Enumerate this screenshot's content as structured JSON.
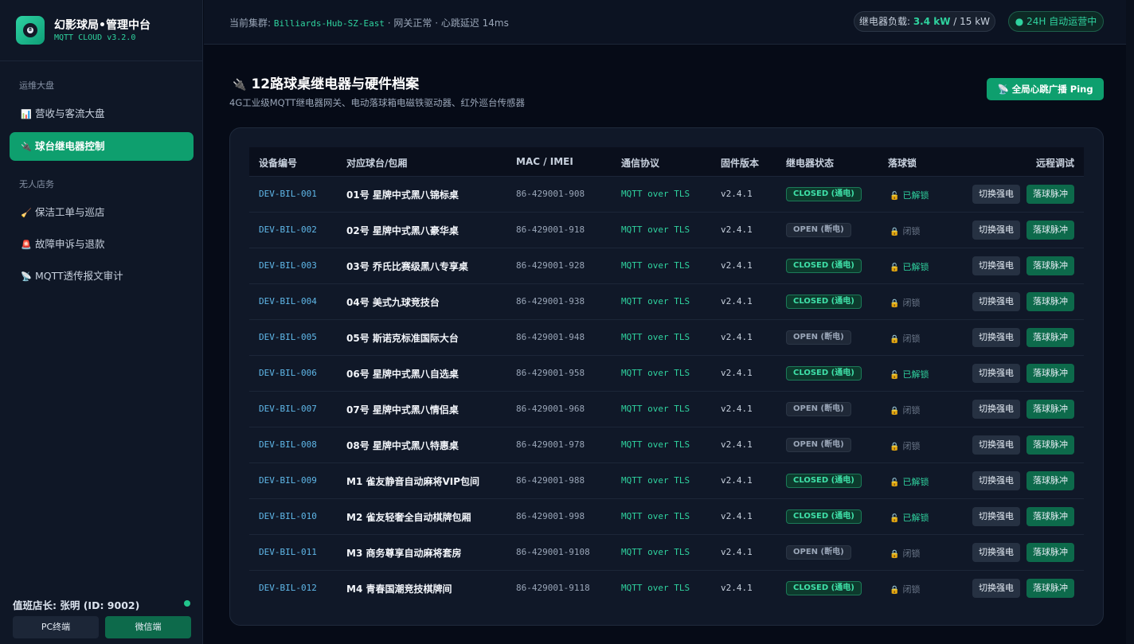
{
  "brand": {
    "title": "幻影球局•管理中台",
    "subtitle": "MQTT CLOUD v3.2.0",
    "logo_glyph": "8"
  },
  "nav": {
    "group1": "运维大盘",
    "group2": "无人店务",
    "items": [
      {
        "icon": "📊",
        "label": "营收与客流大盘"
      },
      {
        "icon": "🔌",
        "label": "球台继电器控制"
      },
      {
        "icon": "🧹",
        "label": "保洁工单与巡店"
      },
      {
        "icon": "🚨",
        "label": "故障申诉与退款"
      },
      {
        "icon": "📡",
        "label": "MQTT透传报文审计"
      }
    ]
  },
  "sidebar_footer": {
    "duty": "值班店长: 张明 (ID: 9002)",
    "pc_label": "PC终端",
    "wx_label": "微信端"
  },
  "topbar": {
    "cluster_prefix": "当前集群: ",
    "cluster_name": "Billiards-Hub-SZ-East",
    "cluster_status": " · 网关正常 · 心跳延迟 14ms",
    "load_label": "继电器负载: ",
    "load_value": "3.4 kW",
    "load_total": " / 15 kW",
    "ops_badge": "● 24H 自动运营中"
  },
  "page": {
    "title_icon": "🔌",
    "title": "12路球桌继电器与硬件档案",
    "subtitle": "4G工业级MQTT继电器网关、电动落球箱电磁铁驱动器、红外巡台传感器",
    "ping_button": "📡 全局心跳广播 Ping"
  },
  "table": {
    "headers": [
      "设备编号",
      "对应球台/包厢",
      "MAC / IMEI",
      "通信协议",
      "固件版本",
      "继电器状态",
      "落球锁",
      "远程调试"
    ],
    "switch_label": "切换强电",
    "pulse_label": "落球脉冲",
    "lock_icon": "🔒",
    "unlock_icon": "🔓",
    "rows": [
      {
        "id": "DEV-BIL-001",
        "table": "01号 星牌中式黑八锦标桌",
        "mac": "86-429001-908",
        "proto": "MQTT over TLS",
        "fw": "v2.4.1",
        "relay": "CLOSED (通电)",
        "relay_state": "closed",
        "lock": "已解锁",
        "lock_state": "unlocked"
      },
      {
        "id": "DEV-BIL-002",
        "table": "02号 星牌中式黑八豪华桌",
        "mac": "86-429001-918",
        "proto": "MQTT over TLS",
        "fw": "v2.4.1",
        "relay": "OPEN (断电)",
        "relay_state": "open",
        "lock": "闭锁",
        "lock_state": "locked"
      },
      {
        "id": "DEV-BIL-003",
        "table": "03号 乔氏比赛级黑八专享桌",
        "mac": "86-429001-928",
        "proto": "MQTT over TLS",
        "fw": "v2.4.1",
        "relay": "CLOSED (通电)",
        "relay_state": "closed",
        "lock": "已解锁",
        "lock_state": "unlocked"
      },
      {
        "id": "DEV-BIL-004",
        "table": "04号 美式九球竞技台",
        "mac": "86-429001-938",
        "proto": "MQTT over TLS",
        "fw": "v2.4.1",
        "relay": "CLOSED (通电)",
        "relay_state": "closed",
        "lock": "闭锁",
        "lock_state": "locked"
      },
      {
        "id": "DEV-BIL-005",
        "table": "05号 斯诺克标准国际大台",
        "mac": "86-429001-948",
        "proto": "MQTT over TLS",
        "fw": "v2.4.1",
        "relay": "OPEN (断电)",
        "relay_state": "open",
        "lock": "闭锁",
        "lock_state": "locked"
      },
      {
        "id": "DEV-BIL-006",
        "table": "06号 星牌中式黑八自选桌",
        "mac": "86-429001-958",
        "proto": "MQTT over TLS",
        "fw": "v2.4.1",
        "relay": "CLOSED (通电)",
        "relay_state": "closed",
        "lock": "已解锁",
        "lock_state": "unlocked"
      },
      {
        "id": "DEV-BIL-007",
        "table": "07号 星牌中式黑八情侣桌",
        "mac": "86-429001-968",
        "proto": "MQTT over TLS",
        "fw": "v2.4.1",
        "relay": "OPEN (断电)",
        "relay_state": "open",
        "lock": "闭锁",
        "lock_state": "locked"
      },
      {
        "id": "DEV-BIL-008",
        "table": "08号 星牌中式黑八特惠桌",
        "mac": "86-429001-978",
        "proto": "MQTT over TLS",
        "fw": "v2.4.1",
        "relay": "OPEN (断电)",
        "relay_state": "open",
        "lock": "闭锁",
        "lock_state": "locked"
      },
      {
        "id": "DEV-BIL-009",
        "table": "M1 雀友静音自动麻将VIP包间",
        "mac": "86-429001-988",
        "proto": "MQTT over TLS",
        "fw": "v2.4.1",
        "relay": "CLOSED (通电)",
        "relay_state": "closed",
        "lock": "已解锁",
        "lock_state": "unlocked"
      },
      {
        "id": "DEV-BIL-010",
        "table": "M2 雀友轻奢全自动棋牌包厢",
        "mac": "86-429001-998",
        "proto": "MQTT over TLS",
        "fw": "v2.4.1",
        "relay": "CLOSED (通电)",
        "relay_state": "closed",
        "lock": "已解锁",
        "lock_state": "unlocked"
      },
      {
        "id": "DEV-BIL-011",
        "table": "M3 商务尊享自动麻将套房",
        "mac": "86-429001-9108",
        "proto": "MQTT over TLS",
        "fw": "v2.4.1",
        "relay": "OPEN (断电)",
        "relay_state": "open",
        "lock": "闭锁",
        "lock_state": "locked"
      },
      {
        "id": "DEV-BIL-012",
        "table": "M4 青春国潮竞技棋牌间",
        "mac": "86-429001-9118",
        "proto": "MQTT over TLS",
        "fw": "v2.4.1",
        "relay": "CLOSED (通电)",
        "relay_state": "closed",
        "lock": "闭锁",
        "lock_state": "locked"
      }
    ]
  }
}
